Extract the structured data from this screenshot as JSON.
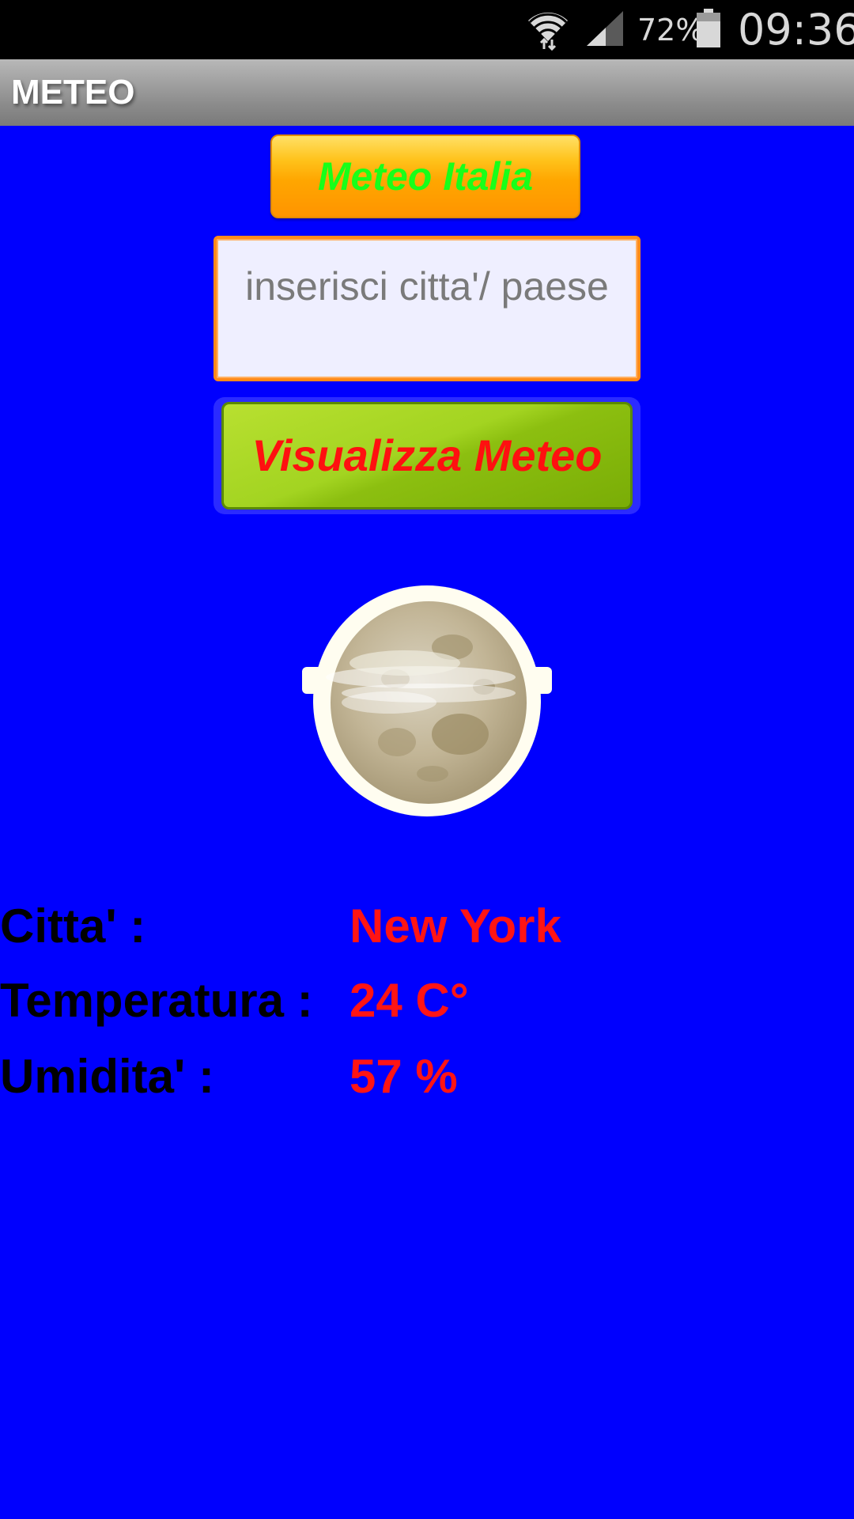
{
  "status_bar": {
    "battery_percent": "72%",
    "time": "09:36"
  },
  "action_bar": {
    "title": "METEO"
  },
  "main": {
    "meteo_italia_button": "Meteo Italia",
    "city_input_placeholder": "inserisci citta'/ paese",
    "city_input_value": "",
    "visualize_button": "Visualizza Meteo",
    "weather_icon": "moon-clouds-icon"
  },
  "info": {
    "city_label": "Citta' :",
    "city_value": "New York",
    "temperature_label": "Temperatura :",
    "temperature_value": "24 C°",
    "humidity_label": "Umidita' :",
    "humidity_value": "57 %"
  },
  "colors": {
    "background": "#0000fe",
    "value_text": "#ff1414",
    "italia_text": "#19ff19",
    "visualize_text": "#ff1010",
    "input_border": "#ff8a1a"
  }
}
